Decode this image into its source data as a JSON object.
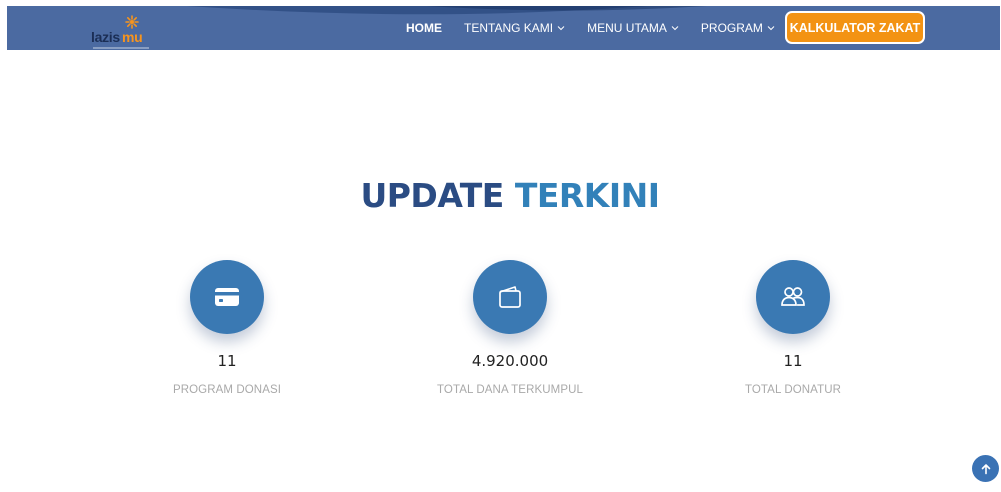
{
  "header": {
    "logo": {
      "text_main": "lazis",
      "text_accent": "mu"
    },
    "nav": [
      {
        "label": "HOME",
        "active": true,
        "dropdown": false
      },
      {
        "label": "TENTANG KAMI",
        "active": false,
        "dropdown": true
      },
      {
        "label": "MENU UTAMA",
        "active": false,
        "dropdown": true
      },
      {
        "label": "PROGRAM",
        "active": false,
        "dropdown": true
      }
    ],
    "cta_label": "KALKULATOR ZAKAT"
  },
  "section": {
    "title_part1": "UPDATE",
    "title_part2": "TERKINI",
    "stats": [
      {
        "icon": "credit-card-icon",
        "value": "11",
        "caption": "PROGRAM DONASI"
      },
      {
        "icon": "wallet-icon",
        "value": "4.920.000",
        "caption": "TOTAL DANA TERKUMPUL"
      },
      {
        "icon": "users-icon",
        "value": "11",
        "caption": "TOTAL DONATUR"
      }
    ]
  },
  "colors": {
    "navbar": "#4b6aa1",
    "cta": "#f39313",
    "title_dark": "#2b4c83",
    "title_light": "#3281b9",
    "icon_circle": "#3a79b3",
    "caption": "#a9a9a9"
  },
  "scroll_top_icon": "arrow-up-icon"
}
